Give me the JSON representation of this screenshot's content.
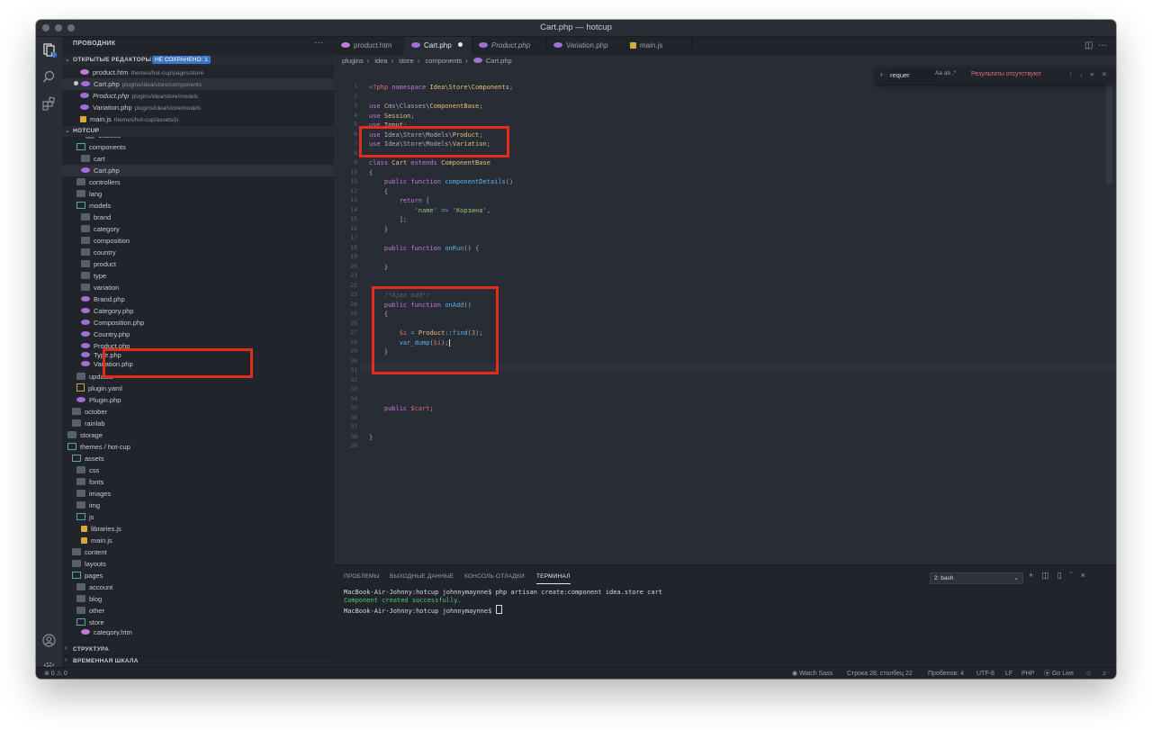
{
  "window": {
    "title": "Cart.php — hotcup"
  },
  "activity_bar": {
    "badge": "1"
  },
  "sidebar": {
    "title": "ПРОВОДНИК",
    "more": "···",
    "open_editors": {
      "label": "ОТКРЫТЫЕ РЕДАКТОРЫ",
      "badge": "НЕ СОХРАНЕНО: 1",
      "items": [
        {
          "name": "product.htm",
          "path": "themes/hot-cup/pages/store"
        },
        {
          "name": "Cart.php",
          "path": "plugins/idea/store/components"
        },
        {
          "name": "Product.php",
          "path": "plugins/idea/store/models"
        },
        {
          "name": "Variation.php",
          "path": "plugins/idea/store/models"
        },
        {
          "name": "main.js",
          "path": "themes/hot-cup/assets/js"
        }
      ]
    },
    "project": {
      "label": "HOTCUP",
      "rows": [
        "classes",
        "components",
        "cart",
        "Cart.php",
        "controllers",
        "lang",
        "models",
        "brand",
        "category",
        "composition",
        "country",
        "product",
        "type",
        "variation",
        "Brand.php",
        "Category.php",
        "Composition.php",
        "Country.php",
        "Product.php",
        "Type.php",
        "Variation.php",
        "updates",
        "plugin.yaml",
        "Plugin.php",
        "october",
        "rainlab",
        "storage",
        "themes / hot-cup",
        "assets",
        "css",
        "fonts",
        "images",
        "img",
        "js",
        "libraries.js",
        "main.js",
        "content",
        "layouts",
        "pages",
        "account",
        "blog",
        "other",
        "store",
        "category.htm"
      ]
    },
    "outline_label": "СТРУКТУРА",
    "timeline_label": "ВРЕМЕННАЯ ШКАЛА"
  },
  "tabs": [
    "product.htm",
    "Cart.php",
    "Product.php",
    "Variation.php",
    "main.js"
  ],
  "breadcrumb": [
    "plugins",
    "idea",
    "store",
    "components",
    "Cart.php"
  ],
  "find_widget": {
    "query": "requer",
    "options": "Aa  ab  .*",
    "result": "Результаты отсутствуют",
    "nav": "↑ ↓ ≡ ✕"
  },
  "editor": {
    "line_numbers": [
      "1",
      "2",
      "3",
      "4",
      "5",
      "6",
      "7",
      "8",
      "9",
      "10",
      "11",
      "12",
      "13",
      "14",
      "15",
      "16",
      "17",
      "18",
      "19",
      "20",
      "21",
      "22",
      "23",
      "24",
      "25",
      "26",
      "27",
      "28",
      "29",
      "30",
      "31",
      "32",
      "33",
      "34",
      "35",
      "36",
      "37",
      "38",
      "39"
    ]
  },
  "panel": {
    "tabs": [
      "ПРОБЛЕМЫ",
      "ВЫХОДНЫЕ ДАННЫЕ",
      "КОНСОЛЬ ОТЛАДКИ",
      "ТЕРМИНАЛ"
    ],
    "terminal_select": "2: bash",
    "terminal_lines": [
      "MacBook-Air-Johnny:hotcup johnnymaynne$ php artisan create:component idea.store cart",
      "Component created successfully.",
      "MacBook-Air-Johnny:hotcup johnnymaynne$ "
    ]
  },
  "status_bar": {
    "problems": "⊗ 0 ⚠ 0",
    "watch_sass": "Watch Sass",
    "position": "Строка 28, столбец 22",
    "spaces": "Пробелов: 4",
    "encoding": "UTF-8",
    "eol": "LF",
    "language": "PHP",
    "go_live": "Go Live"
  }
}
